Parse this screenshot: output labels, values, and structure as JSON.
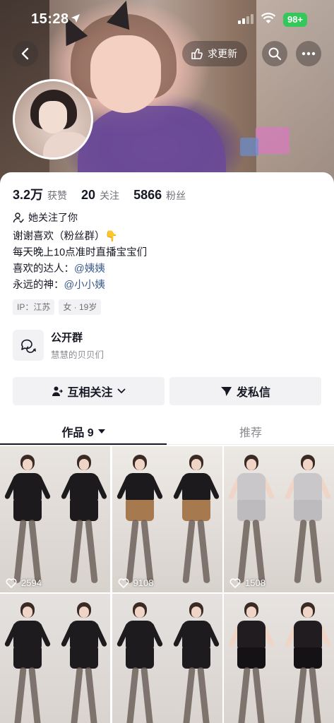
{
  "status_bar": {
    "time": "15:28",
    "battery": "98+"
  },
  "header": {
    "update_button_label": "求更新"
  },
  "stats": [
    {
      "value": "3.2万",
      "label": "获赞"
    },
    {
      "value": "20",
      "label": "关注"
    },
    {
      "value": "5866",
      "label": "粉丝"
    }
  ],
  "follows_you": "她关注了你",
  "bio": {
    "line1": "谢谢喜欢（粉丝群）👇",
    "line2": "每天晚上10点准时直播宝宝们",
    "line3_prefix": "喜欢的达人：",
    "line3_mention": "@姨姨",
    "line4_prefix": "永远的神：",
    "line4_mention": "@小小姨"
  },
  "tags": {
    "ip": "IP：江苏",
    "gender_age": "女 · 19岁"
  },
  "group": {
    "title": "公开群",
    "subtitle": "慧慧的贝贝们"
  },
  "actions": {
    "mutual_follow": "互相关注",
    "message": "发私信"
  },
  "tabs": {
    "works": "作品 9",
    "recommend": "推荐"
  },
  "videos": [
    {
      "views": "2594",
      "outfit": "black",
      "alt_outfit": "black"
    },
    {
      "views": "9108",
      "outfit": "leopard",
      "alt_outfit": "leopard"
    },
    {
      "views": "1508",
      "outfit": "grey",
      "alt_outfit": "grey"
    },
    {
      "views": "",
      "outfit": "black-bodysuit",
      "alt_outfit": "black-bodysuit"
    },
    {
      "views": "",
      "outfit": "black-bodysuit",
      "alt_outfit": "black-bodysuit"
    },
    {
      "views": "",
      "outfit": "black-skirt",
      "alt_outfit": "black-skirt"
    }
  ],
  "colors": {
    "battery": "#34c759",
    "mention": "#3a5a8c",
    "tab_active": "#161823",
    "tab_inactive": "#8a8b91"
  }
}
